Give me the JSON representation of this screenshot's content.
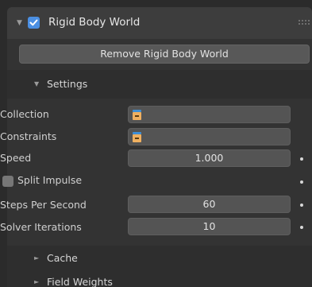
{
  "panel": {
    "title": "Rigid Body World",
    "enabled": true,
    "remove_button_label": "Remove Rigid Body World"
  },
  "settings": {
    "title": "Settings",
    "collection_label": "Collection",
    "collection_value": "",
    "constraints_label": "Constraints",
    "constraints_value": "",
    "speed_label": "Speed",
    "speed_value": "1.000",
    "split_impulse_label": "Split Impulse",
    "split_impulse_checked": false,
    "steps_label": "Steps Per Second",
    "steps_value": "60",
    "solver_label": "Solver Iterations",
    "solver_value": "10"
  },
  "subpanels": {
    "cache_label": "Cache",
    "field_weights_label": "Field Weights"
  },
  "icons": {
    "expand": "disclosure-triangle-down-icon",
    "collapsed": "disclosure-triangle-right-icon",
    "collection": "collection-icon",
    "keyframe": "keyframe-dot-icon",
    "grip": "drag-grip-icon"
  },
  "colors": {
    "accent": "#4b8fe2",
    "collection_icon": "#f0b060"
  }
}
